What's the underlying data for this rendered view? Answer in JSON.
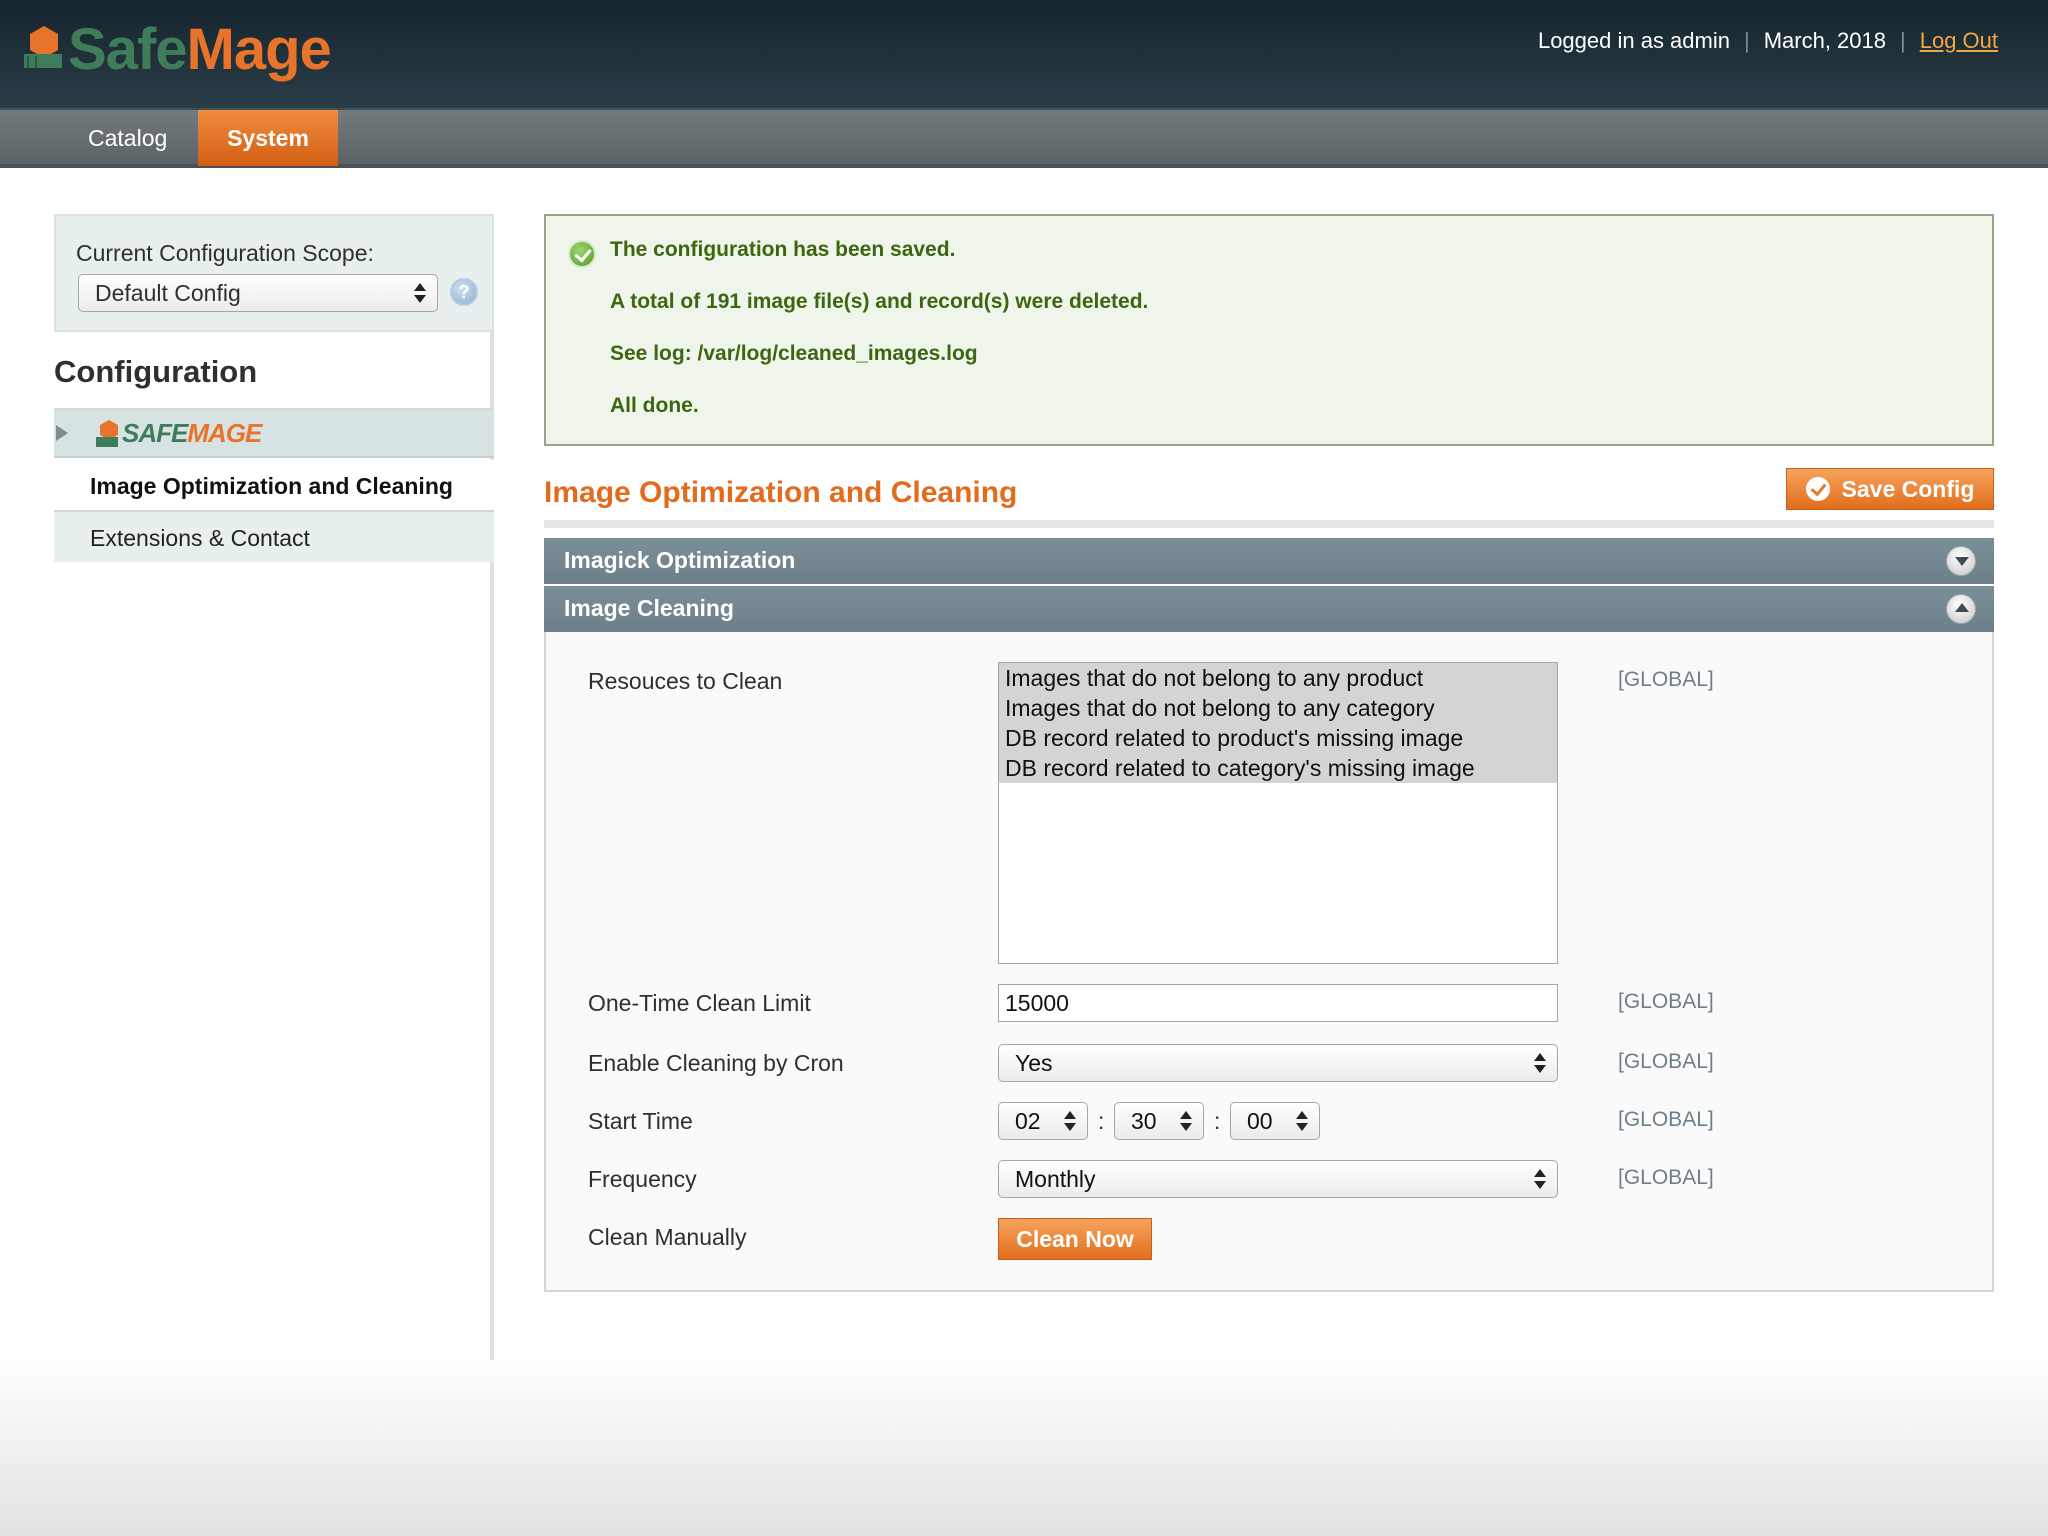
{
  "app": {
    "logo_safe": "Safe",
    "logo_mage": "Mage"
  },
  "header": {
    "logged_in": "Logged in as admin",
    "sep1": "|",
    "date": "March, 2018",
    "sep2": "|",
    "logout": "Log Out"
  },
  "nav": {
    "items": [
      {
        "label": "Catalog"
      },
      {
        "label": "System",
        "active": true
      }
    ]
  },
  "sidebar": {
    "scope_label": "Current Configuration Scope:",
    "scope_value": "Default Config",
    "heading": "Configuration",
    "group_logo_safe": "SAFE",
    "group_logo_mage": "MAGE",
    "items": [
      {
        "label": "Image Optimization and Cleaning",
        "active": true
      },
      {
        "label": "Extensions & Contact"
      }
    ]
  },
  "messages": [
    "The configuration has been saved.",
    "A total of 191 image file(s) and record(s) were deleted.",
    "See log: /var/log/cleaned_images.log",
    "All done."
  ],
  "content": {
    "title": "Image Optimization and Cleaning",
    "save_label": "Save Config",
    "sections": [
      {
        "title": "Imagick Optimization",
        "state": "collapsed"
      },
      {
        "title": "Image Cleaning",
        "state": "expanded"
      }
    ]
  },
  "fields": {
    "resources": {
      "label": "Resouces to Clean",
      "options": [
        "Images that do not belong to any product",
        "Images that do not belong to any category",
        "DB record related to product's missing image",
        "DB record related to category's missing image"
      ],
      "scope": "[GLOBAL]"
    },
    "limit": {
      "label": "One-Time Clean Limit",
      "value": "15000",
      "scope": "[GLOBAL]"
    },
    "cron": {
      "label": "Enable Cleaning by Cron",
      "value": "Yes",
      "scope": "[GLOBAL]"
    },
    "start_time": {
      "label": "Start Time",
      "hour": "02",
      "minute": "30",
      "second": "00",
      "sep": ":",
      "scope": "[GLOBAL]"
    },
    "frequency": {
      "label": "Frequency",
      "value": "Monthly",
      "scope": "[GLOBAL]"
    },
    "manual": {
      "label": "Clean Manually",
      "button": "Clean Now"
    }
  },
  "colors": {
    "accent_orange": "#e26b1d",
    "header_dark": "#16242c",
    "section_head": "#6d7f89",
    "success_text": "#3d6611",
    "success_bg": "#eff5ea"
  }
}
